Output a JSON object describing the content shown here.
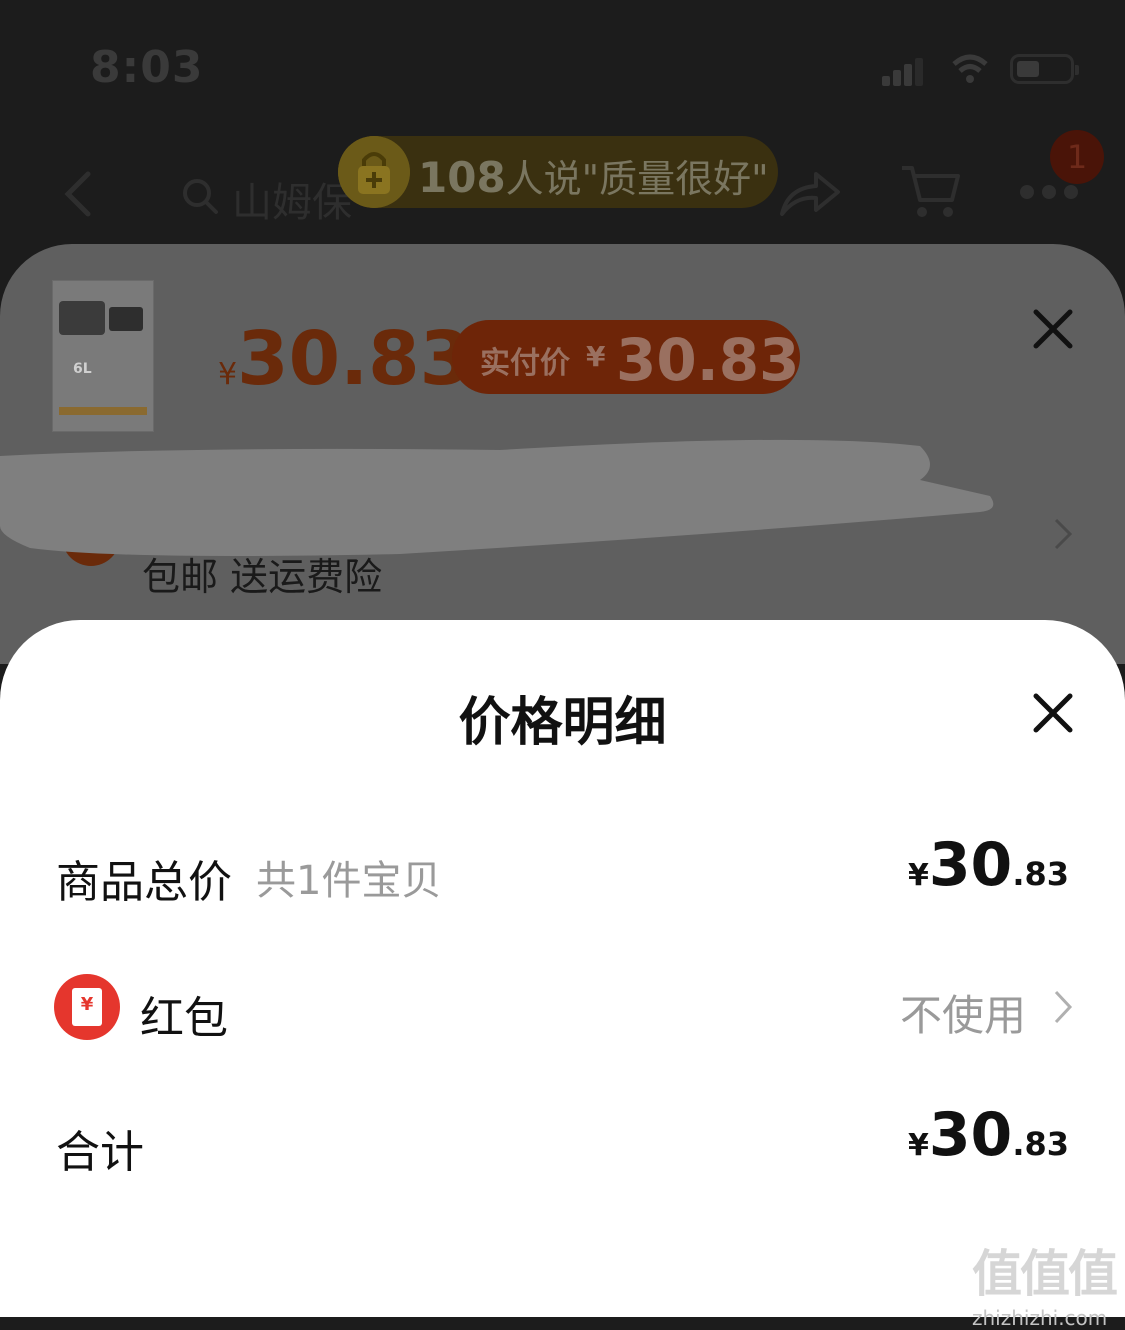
{
  "status_bar": {
    "time": "8:03"
  },
  "nav": {
    "search_text": "山姆保",
    "cart_badge": "1",
    "review_count": "108",
    "review_text": "人说\"质量很好\""
  },
  "product": {
    "thumb_label": "6L",
    "price_symbol": "¥",
    "price": "30.83",
    "paid_label": "实付价",
    "paid_symbol": "¥",
    "paid_price": "30.83",
    "shipping_text": "包邮  送运费险"
  },
  "sheet": {
    "title": "价格明细",
    "rows": {
      "total_goods": {
        "label": "商品总价",
        "sub": "共1件宝贝",
        "symbol": "¥",
        "int": "30",
        "dec": ".83"
      },
      "red_packet": {
        "label": "红包",
        "value": "不使用",
        "icon_glyph": "¥"
      },
      "sum": {
        "label": "合计",
        "symbol": "¥",
        "int": "30",
        "dec": ".83"
      }
    }
  },
  "watermark": {
    "glyphs": "值值值",
    "url": "zhizhizhi.com"
  },
  "colors": {
    "brand_orange": "#ff5000",
    "red_packet": "#e5362d"
  }
}
